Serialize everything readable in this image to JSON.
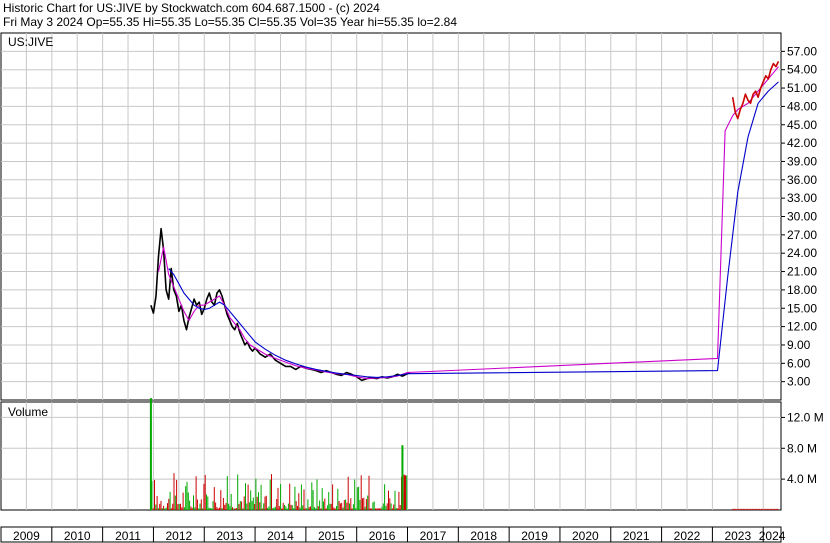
{
  "header": {
    "line1": "Historic Chart for US:JIVE by Stockwatch.com 604.687.1500 - (c) 2024",
    "line2": "Fri May  3 2024   Op=55.35  Hi=55.35  Lo=55.35  Cl=55.35  Vol=35  Year hi=55.35  lo=2.84"
  },
  "colors": {
    "price": "#000000",
    "price_accent": "#cc0000",
    "ma_short": "#cc00cc",
    "ma_long": "#0000cc",
    "vol_up": "#00aa00",
    "vol_down": "#cc0000",
    "grid": "#c8c8c8"
  },
  "chart_data": [
    {
      "type": "line",
      "panel": "price",
      "title": "US:JIVE",
      "ylim": [
        0,
        60
      ],
      "yticks": [
        "57.00",
        "54.00",
        "51.00",
        "48.00",
        "45.00",
        "42.00",
        "39.00",
        "36.00",
        "33.00",
        "30.00",
        "27.00",
        "24.00",
        "21.00",
        "18.00",
        "15.00",
        "12.00",
        "9.00",
        "6.00",
        "3.00"
      ],
      "ytick_values": [
        57,
        54,
        51,
        48,
        45,
        42,
        39,
        36,
        33,
        30,
        27,
        24,
        21,
        18,
        15,
        12,
        9,
        6,
        3
      ],
      "xlim": [
        2009,
        2024.35
      ],
      "x_ticks": [
        "2009",
        "2010",
        "2011",
        "2012",
        "2013",
        "2014",
        "2015",
        "2016",
        "2017",
        "2018",
        "2019",
        "2020",
        "2021",
        "2022",
        "2023",
        "2024"
      ],
      "grid": true,
      "series": [
        {
          "role": "price",
          "x": [
            2011.95,
            2012.0,
            2012.05,
            2012.1,
            2012.15,
            2012.2,
            2012.25,
            2012.3,
            2012.35,
            2012.4,
            2012.45,
            2012.5,
            2012.55,
            2012.6,
            2012.65,
            2012.7,
            2012.75,
            2012.8,
            2012.85,
            2012.9,
            2012.95,
            2013.0,
            2013.05,
            2013.1,
            2013.15,
            2013.2,
            2013.25,
            2013.3,
            2013.35,
            2013.4,
            2013.45,
            2013.5,
            2013.55,
            2013.6,
            2013.65,
            2013.7,
            2013.75,
            2013.8,
            2013.85,
            2013.9,
            2013.95,
            2014.0,
            2014.1,
            2014.2,
            2014.3,
            2014.4,
            2014.5,
            2014.6,
            2014.7,
            2014.8,
            2014.9,
            2015.0,
            2015.1,
            2015.2,
            2015.3,
            2015.4,
            2015.5,
            2015.6,
            2015.7,
            2015.8,
            2015.9,
            2016.0,
            2016.1,
            2016.2,
            2016.3,
            2016.4,
            2016.5,
            2016.6,
            2016.7,
            2016.8,
            2016.9,
            2017.0,
            2017.05
          ],
          "y": [
            15.5,
            14.2,
            17.0,
            23.5,
            28.0,
            24.5,
            18.0,
            16.5,
            21.5,
            18.0,
            17.0,
            14.5,
            15.5,
            13.0,
            11.5,
            13.5,
            15.0,
            16.5,
            15.5,
            16.0,
            14.0,
            15.0,
            16.5,
            17.5,
            16.0,
            15.5,
            17.5,
            18.0,
            17.0,
            15.5,
            14.0,
            13.0,
            12.0,
            11.5,
            12.5,
            11.0,
            10.0,
            9.0,
            9.5,
            8.5,
            8.0,
            8.5,
            7.5,
            7.0,
            7.5,
            6.5,
            6.0,
            5.5,
            5.5,
            5.0,
            5.5,
            5.2,
            5.0,
            4.8,
            4.5,
            4.8,
            4.5,
            4.2,
            4.0,
            4.5,
            4.2,
            3.8,
            3.2,
            3.5,
            3.6,
            3.5,
            3.8,
            3.6,
            3.8,
            4.2,
            3.9,
            4.3,
            4.5
          ]
        },
        {
          "role": "moving_average_short",
          "x": [
            2012.1,
            2012.2,
            2012.3,
            2012.4,
            2012.5,
            2012.6,
            2012.7,
            2012.8,
            2012.9,
            2013.0,
            2013.1,
            2013.2,
            2013.3,
            2013.4,
            2013.5,
            2013.6,
            2013.7,
            2013.8,
            2013.9,
            2014.0,
            2014.2,
            2014.4,
            2014.6,
            2014.8,
            2015.0,
            2015.2,
            2015.4,
            2015.6,
            2015.8,
            2016.0,
            2016.2,
            2016.4,
            2016.6,
            2016.8,
            2017.0,
            2023.1,
            2023.25,
            2023.4,
            2023.5,
            2023.6,
            2023.7,
            2023.8,
            2023.9,
            2024.0,
            2024.1,
            2024.2,
            2024.3
          ],
          "y": [
            21.0,
            25.0,
            20.5,
            18.5,
            16.5,
            14.5,
            13.0,
            14.5,
            15.5,
            15.5,
            16.0,
            16.5,
            17.0,
            15.5,
            13.5,
            12.5,
            11.5,
            10.0,
            9.0,
            8.5,
            7.5,
            6.8,
            6.2,
            5.6,
            5.2,
            4.9,
            4.6,
            4.3,
            4.2,
            3.8,
            3.5,
            3.6,
            3.7,
            3.9,
            4.5,
            6.8,
            44.0,
            46.5,
            47.5,
            48.0,
            48.5,
            49.5,
            50.5,
            51.5,
            52.5,
            53.5,
            54.5
          ]
        },
        {
          "role": "moving_average_long",
          "x": [
            2012.3,
            2012.4,
            2012.5,
            2012.6,
            2012.7,
            2012.8,
            2012.9,
            2013.0,
            2013.1,
            2013.2,
            2013.3,
            2013.4,
            2013.5,
            2013.6,
            2013.7,
            2013.8,
            2013.9,
            2014.0,
            2014.2,
            2014.4,
            2014.6,
            2014.8,
            2015.0,
            2015.2,
            2015.4,
            2015.6,
            2015.8,
            2016.0,
            2016.2,
            2016.4,
            2016.6,
            2016.8,
            2017.0,
            2023.1,
            2023.3,
            2023.5,
            2023.7,
            2023.9,
            2024.1,
            2024.3
          ],
          "y": [
            21.5,
            20.5,
            19.0,
            17.5,
            16.5,
            15.5,
            15.0,
            14.8,
            15.0,
            15.5,
            16.0,
            15.5,
            14.5,
            13.5,
            12.5,
            11.5,
            10.5,
            9.5,
            8.3,
            7.3,
            6.5,
            5.9,
            5.4,
            5.0,
            4.7,
            4.4,
            4.2,
            4.0,
            3.8,
            3.7,
            3.8,
            4.0,
            4.3,
            4.8,
            20.0,
            34.0,
            43.0,
            48.5,
            50.5,
            52.0
          ]
        },
        {
          "role": "price_recent",
          "x": [
            2023.4,
            2023.45,
            2023.5,
            2023.55,
            2023.6,
            2023.65,
            2023.7,
            2023.75,
            2023.8,
            2023.85,
            2023.9,
            2023.95,
            2024.0,
            2024.05,
            2024.1,
            2024.15,
            2024.2,
            2024.25,
            2024.3
          ],
          "y": [
            49.5,
            47.0,
            46.0,
            47.5,
            48.5,
            50.0,
            49.0,
            48.5,
            50.0,
            50.5,
            49.5,
            51.0,
            52.0,
            53.0,
            52.5,
            54.0,
            55.0,
            54.5,
            55.35
          ]
        }
      ]
    },
    {
      "type": "bar",
      "panel": "volume",
      "title": "Volume",
      "ylim": [
        0,
        14
      ],
      "yticks": [
        "12.0 M",
        "8.0 M",
        "4.0 M"
      ],
      "ytick_values": [
        12,
        8,
        4
      ],
      "unit": "M",
      "x_ticks": [
        "2009",
        "2010",
        "2011",
        "2012",
        "2013",
        "2014",
        "2015",
        "2016",
        "2017",
        "2018",
        "2019",
        "2020",
        "2021",
        "2022",
        "2023",
        "2024"
      ],
      "spikes": [
        {
          "x": 2011.95,
          "value": 14.5
        },
        {
          "x": 2016.9,
          "value": 8.4
        },
        {
          "x": 2016.95,
          "value": 4.5
        }
      ],
      "typical_volume": {
        "start": 2011.95,
        "end": 2017.0,
        "min": 0.2,
        "max": 4.8
      },
      "recent_volume": {
        "start": 2023.4,
        "end": 2024.3,
        "value": 0.15
      }
    }
  ]
}
